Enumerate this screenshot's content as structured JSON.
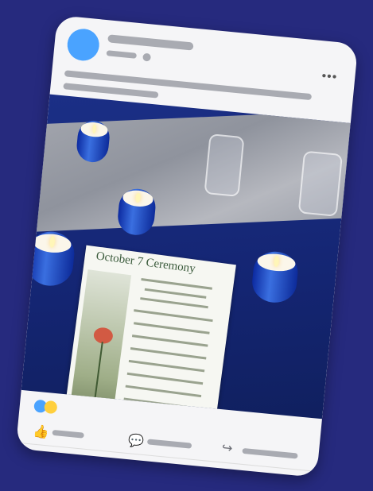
{
  "post": {
    "more_label": "•••",
    "photo_alt": "Photo of candles on a table with a ceremony program",
    "program_title": "October 7 Ceremony"
  },
  "colors": {
    "background": "#262a7e",
    "card": "#f5f5f7",
    "avatar": "#4aa3ff",
    "reaction_blue": "#4aa3ff",
    "reaction_yellow": "#ffcf3d"
  },
  "actions": {
    "like_icon": "thumbs-up-icon",
    "comment_icon": "comment-icon",
    "share_icon": "share-icon"
  }
}
